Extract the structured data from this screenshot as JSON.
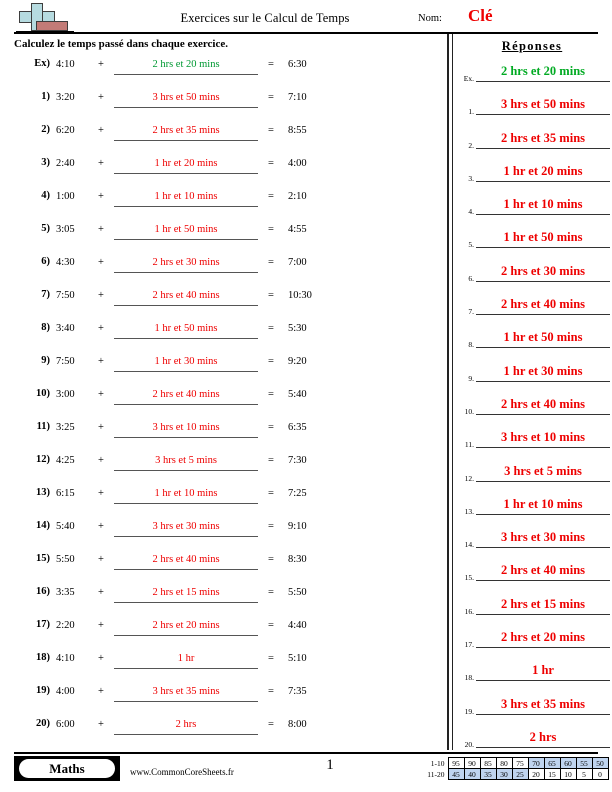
{
  "header": {
    "title": "Exercices sur le Calcul de Temps",
    "name_label": "Nom:",
    "name_value": "Clé",
    "logo_icon": "plus-block-logo"
  },
  "instruction": "Calculez le temps passé dans chaque exercice.",
  "answers_heading": "Réponses",
  "colors": {
    "example_green": "#009933",
    "answer_red": "#ee0000",
    "highlight_blue": "#bfd4ef",
    "logo_cyan": "#b6dbe0",
    "logo_red": "#c37b77"
  },
  "problems": [
    {
      "num": "Ex)",
      "start": "4:10",
      "op": "+",
      "answer": "2 hrs et 20 mins",
      "eq": "=",
      "result": "6:30",
      "is_example": true
    },
    {
      "num": "1)",
      "start": "3:20",
      "op": "+",
      "answer": "3 hrs et 50 mins",
      "eq": "=",
      "result": "7:10",
      "is_example": false
    },
    {
      "num": "2)",
      "start": "6:20",
      "op": "+",
      "answer": "2 hrs et 35 mins",
      "eq": "=",
      "result": "8:55",
      "is_example": false
    },
    {
      "num": "3)",
      "start": "2:40",
      "op": "+",
      "answer": "1 hr et 20 mins",
      "eq": "=",
      "result": "4:00",
      "is_example": false
    },
    {
      "num": "4)",
      "start": "1:00",
      "op": "+",
      "answer": "1 hr et 10 mins",
      "eq": "=",
      "result": "2:10",
      "is_example": false
    },
    {
      "num": "5)",
      "start": "3:05",
      "op": "+",
      "answer": "1 hr et 50 mins",
      "eq": "=",
      "result": "4:55",
      "is_example": false
    },
    {
      "num": "6)",
      "start": "4:30",
      "op": "+",
      "answer": "2 hrs et 30 mins",
      "eq": "=",
      "result": "7:00",
      "is_example": false
    },
    {
      "num": "7)",
      "start": "7:50",
      "op": "+",
      "answer": "2 hrs et 40 mins",
      "eq": "=",
      "result": "10:30",
      "is_example": false
    },
    {
      "num": "8)",
      "start": "3:40",
      "op": "+",
      "answer": "1 hr et 50 mins",
      "eq": "=",
      "result": "5:30",
      "is_example": false
    },
    {
      "num": "9)",
      "start": "7:50",
      "op": "+",
      "answer": "1 hr et 30 mins",
      "eq": "=",
      "result": "9:20",
      "is_example": false
    },
    {
      "num": "10)",
      "start": "3:00",
      "op": "+",
      "answer": "2 hrs et 40 mins",
      "eq": "=",
      "result": "5:40",
      "is_example": false
    },
    {
      "num": "11)",
      "start": "3:25",
      "op": "+",
      "answer": "3 hrs et 10 mins",
      "eq": "=",
      "result": "6:35",
      "is_example": false
    },
    {
      "num": "12)",
      "start": "4:25",
      "op": "+",
      "answer": "3 hrs et 5 mins",
      "eq": "=",
      "result": "7:30",
      "is_example": false
    },
    {
      "num": "13)",
      "start": "6:15",
      "op": "+",
      "answer": "1 hr et 10 mins",
      "eq": "=",
      "result": "7:25",
      "is_example": false
    },
    {
      "num": "14)",
      "start": "5:40",
      "op": "+",
      "answer": "3 hrs et 30 mins",
      "eq": "=",
      "result": "9:10",
      "is_example": false
    },
    {
      "num": "15)",
      "start": "5:50",
      "op": "+",
      "answer": "2 hrs et 40 mins",
      "eq": "=",
      "result": "8:30",
      "is_example": false
    },
    {
      "num": "16)",
      "start": "3:35",
      "op": "+",
      "answer": "2 hrs et 15 mins",
      "eq": "=",
      "result": "5:50",
      "is_example": false
    },
    {
      "num": "17)",
      "start": "2:20",
      "op": "+",
      "answer": "2 hrs et 20 mins",
      "eq": "=",
      "result": "4:40",
      "is_example": false
    },
    {
      "num": "18)",
      "start": "4:10",
      "op": "+",
      "answer": "1 hr",
      "eq": "=",
      "result": "5:10",
      "is_example": false
    },
    {
      "num": "19)",
      "start": "4:00",
      "op": "+",
      "answer": "3 hrs et 35 mins",
      "eq": "=",
      "result": "7:35",
      "is_example": false
    },
    {
      "num": "20)",
      "start": "6:00",
      "op": "+",
      "answer": "2 hrs",
      "eq": "=",
      "result": "8:00",
      "is_example": false
    }
  ],
  "answer_key": [
    {
      "num": "Ex.",
      "value": "2 hrs et 20 mins",
      "is_example": true
    },
    {
      "num": "1.",
      "value": "3 hrs et 50 mins",
      "is_example": false
    },
    {
      "num": "2.",
      "value": "2 hrs et 35 mins",
      "is_example": false
    },
    {
      "num": "3.",
      "value": "1 hr et 20 mins",
      "is_example": false
    },
    {
      "num": "4.",
      "value": "1 hr et 10 mins",
      "is_example": false
    },
    {
      "num": "5.",
      "value": "1 hr et 50 mins",
      "is_example": false
    },
    {
      "num": "6.",
      "value": "2 hrs et 30 mins",
      "is_example": false
    },
    {
      "num": "7.",
      "value": "2 hrs et 40 mins",
      "is_example": false
    },
    {
      "num": "8.",
      "value": "1 hr et 50 mins",
      "is_example": false
    },
    {
      "num": "9.",
      "value": "1 hr et 30 mins",
      "is_example": false
    },
    {
      "num": "10.",
      "value": "2 hrs et 40 mins",
      "is_example": false
    },
    {
      "num": "11.",
      "value": "3 hrs et 10 mins",
      "is_example": false
    },
    {
      "num": "12.",
      "value": "3 hrs et 5 mins",
      "is_example": false
    },
    {
      "num": "13.",
      "value": "1 hr et 10 mins",
      "is_example": false
    },
    {
      "num": "14.",
      "value": "3 hrs et 30 mins",
      "is_example": false
    },
    {
      "num": "15.",
      "value": "2 hrs et 40 mins",
      "is_example": false
    },
    {
      "num": "16.",
      "value": "2 hrs et 15 mins",
      "is_example": false
    },
    {
      "num": "17.",
      "value": "2 hrs et 20 mins",
      "is_example": false
    },
    {
      "num": "18.",
      "value": "1 hr",
      "is_example": false
    },
    {
      "num": "19.",
      "value": "3 hrs et 35 mins",
      "is_example": false
    },
    {
      "num": "20.",
      "value": "2 hrs",
      "is_example": false
    }
  ],
  "footer": {
    "badge": "Maths",
    "site": "www.CommonCoreSheets.fr",
    "page": "1",
    "scale": {
      "rows": [
        {
          "label": "1-10",
          "cells": [
            {
              "v": "95",
              "hl": false
            },
            {
              "v": "90",
              "hl": false
            },
            {
              "v": "85",
              "hl": false
            },
            {
              "v": "80",
              "hl": false
            },
            {
              "v": "75",
              "hl": false
            },
            {
              "v": "70",
              "hl": true
            },
            {
              "v": "65",
              "hl": true
            },
            {
              "v": "60",
              "hl": true
            },
            {
              "v": "55",
              "hl": true
            },
            {
              "v": "50",
              "hl": true
            }
          ]
        },
        {
          "label": "11-20",
          "cells": [
            {
              "v": "45",
              "hl": true
            },
            {
              "v": "40",
              "hl": true
            },
            {
              "v": "35",
              "hl": true
            },
            {
              "v": "30",
              "hl": true
            },
            {
              "v": "25",
              "hl": true
            },
            {
              "v": "20",
              "hl": false
            },
            {
              "v": "15",
              "hl": false
            },
            {
              "v": "10",
              "hl": false
            },
            {
              "v": "5",
              "hl": false
            },
            {
              "v": "0",
              "hl": false
            }
          ]
        }
      ]
    }
  }
}
